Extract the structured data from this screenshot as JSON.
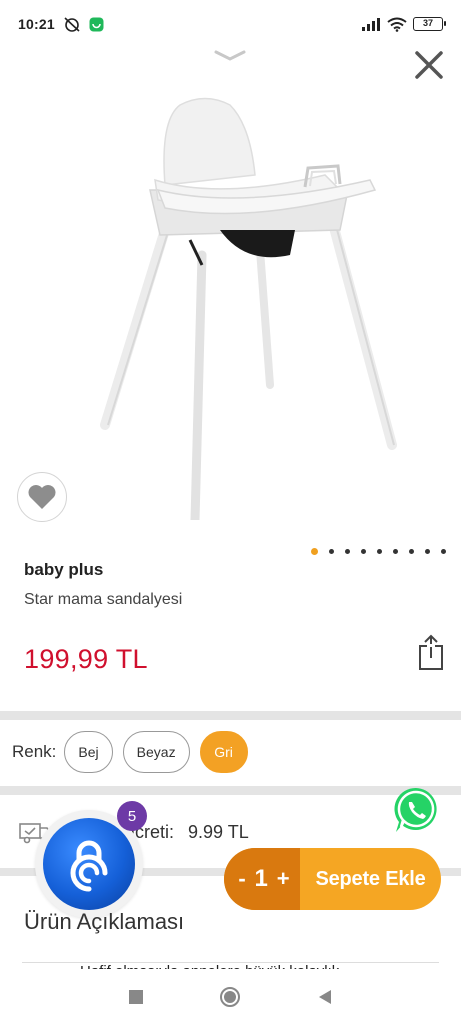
{
  "status_bar": {
    "time": "10:21",
    "battery": "37"
  },
  "product": {
    "brand": "baby plus",
    "name": "Star mama sandalyesi",
    "price": "199,99 TL",
    "image_count": 9,
    "active_image_index": 0
  },
  "colors": {
    "label": "Renk:",
    "options": [
      "Bej",
      "Beyaz",
      "Gri"
    ],
    "selected": "Gri"
  },
  "shipping": {
    "label": "Ücreti:",
    "value": "9.99 TL"
  },
  "cart": {
    "minus": "-",
    "quantity": "1",
    "plus": "+",
    "add_label": "Sepete Ekle"
  },
  "app_badge": {
    "count": "5"
  },
  "description": {
    "title": "Ürün Açıklaması",
    "preview": "Hafif olmasıyla annelere büyük kolaylık"
  },
  "theme": {
    "accent": "#f5a623",
    "price_color": "#d0102e",
    "badge_color": "#6d3aa6",
    "whatsapp_color": "#25d366"
  }
}
